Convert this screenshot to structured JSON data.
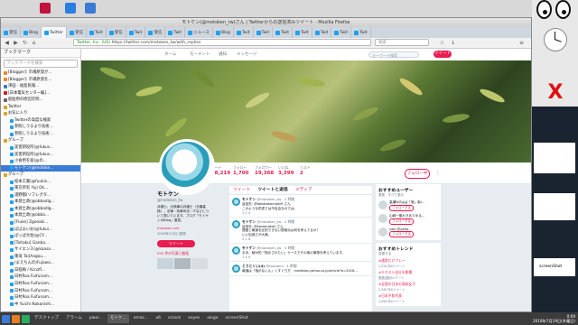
{
  "window": {
    "title": "モトケン(@motoken_tw)さん | Twitterからの送信済みツイート - Mozilla Firefox",
    "url_domain": "Twitter, Inc. (US)",
    "url_path": "https://twitter.com/motoken_tw/with_replies",
    "search_placeholder": "検索"
  },
  "tabs": [
    {
      "label": "受信"
    },
    {
      "label": "Blog"
    },
    {
      "label": "Twitter"
    },
    {
      "label": "受信"
    },
    {
      "label": "Twit"
    },
    {
      "label": "受信"
    },
    {
      "label": "Twit"
    },
    {
      "label": "受信"
    },
    {
      "label": "Twit"
    },
    {
      "label": "ニュース"
    },
    {
      "label": "Blog"
    },
    {
      "label": "Twit"
    },
    {
      "label": "Twit"
    },
    {
      "label": "Twit"
    },
    {
      "label": "Twit"
    },
    {
      "label": "Twit"
    },
    {
      "label": "Twit"
    },
    {
      "label": "Twit"
    }
  ],
  "sidebar": {
    "title": "ブックマーク",
    "search_placeholder": "ブックマークを検索",
    "items": [
      {
        "label": "[Blogger]: 市場原発が...",
        "color": "#f58220"
      },
      {
        "label": "[Blogger]: 市場原発を...",
        "color": "#f58220"
      },
      {
        "label": "津田 - 福島民報...",
        "color": "#3a7bd5"
      },
      {
        "label": "[日本電気センター編]...",
        "color": "#c22"
      },
      {
        "label": "船舶用の原因究明...",
        "color": "#666"
      },
      {
        "label": "Twitter",
        "color": "#d9a520"
      },
      {
        "label": "お気に入り",
        "color": "#d9a520"
      },
      {
        "label": "Twitterの高度な検索",
        "color": "#1da1f2"
      },
      {
        "label": "参照しうるより技術...",
        "color": "#1da1f2"
      },
      {
        "label": "参照しうるより技術...",
        "color": "#1da1f2"
      },
      {
        "label": "グループ",
        "color": "#d9a520"
      },
      {
        "label": "実害新役所(@fukus...",
        "color": "#1da1f2"
      },
      {
        "label": "実害新役所(@fukus...",
        "color": "#1da1f2"
      },
      {
        "label": "小食用を家(@の...",
        "color": "#1da1f2"
      },
      {
        "label": "モトケン(@motoke...",
        "color": "#1da1f2"
      },
      {
        "label": "グループ",
        "color": "#d9a520"
      },
      {
        "label": "松本工業(@fuukis...",
        "color": "#1da1f2"
      },
      {
        "label": "東京所有 Yuji Ok...",
        "color": "#1da1f2"
      },
      {
        "label": "浦野都(ソフレグタ...",
        "color": "#1da1f2"
      },
      {
        "label": "本源土政(@obbadig...",
        "color": "#1da1f2"
      },
      {
        "label": "本源土政(@obbadig...",
        "color": "#1da1f2"
      },
      {
        "label": "本源土政(@obba...",
        "color": "#1da1f2"
      },
      {
        "label": "[Fluke] Zgoeaki...",
        "color": "#1da1f2"
      },
      {
        "label": "ばばまいお(@fukui...",
        "color": "#1da1f2"
      },
      {
        "label": "ぱっぱ大佐(@CY...",
        "color": "#1da1f2"
      },
      {
        "label": "[Teitaku] Ganba...",
        "color": "#1da1f2"
      },
      {
        "label": "サイエンス(@kaasa...",
        "color": "#1da1f2"
      },
      {
        "label": "東海 Tai(Aagou...",
        "color": "#1da1f2"
      },
      {
        "label": "(まえちんの)Fujawa...",
        "color": "#1da1f2"
      },
      {
        "label": "日程梅 / Kcnzfl...",
        "color": "#1da1f2"
      },
      {
        "label": "日村Roa Fuifunam...",
        "color": "#1da1f2"
      },
      {
        "label": "日村Roa Fuifunam...",
        "color": "#1da1f2"
      },
      {
        "label": "日村Roa Fuifunam...",
        "color": "#1da1f2"
      },
      {
        "label": "日村Roa Fuifunam...",
        "color": "#1da1f2"
      },
      {
        "label": "中 Yuichi Nakanishi...",
        "color": "#1da1f2"
      }
    ]
  },
  "twitter": {
    "nav": [
      "ホーム",
      "モーメント",
      "通知",
      "メッセージ"
    ],
    "search_placeholder": "キーワード検索",
    "tweet_button": "ツイート",
    "stats": [
      {
        "label": "ツイート",
        "value": "108,219"
      },
      {
        "label": "フォロー",
        "value": "1,700"
      },
      {
        "label": "フォロワー",
        "value": "19,368"
      },
      {
        "label": "いいね",
        "value": "3,399"
      },
      {
        "label": "リスト",
        "value": "2"
      }
    ],
    "follow_button": "フォロー中",
    "profile": {
      "name": "モトケン",
      "handle": "@motoken_tw",
      "bio": "弁護士。元検事の弁護士（元最高検）。法律・刑事司法・ITなどについて書いています。ブログ「モトケンのBlog」運営。",
      "link": "motoken.net",
      "joined": "2009年12月に登録",
      "media_label": "555 件の写真と動画",
      "tweet_button": "ツイート"
    },
    "timeline_tabs": [
      "ツイート",
      "ツイートと返信",
      "メディア"
    ],
    "tweets": [
      {
        "name": "モトケン",
        "handle": "@motoken_tw · 2 時間",
        "text": "返信先: @bakatakamioki9 さん\nこのような供述では不自由なのでは。",
        "actions": "1   1   4"
      },
      {
        "name": "モトケン",
        "handle": "@motoken_tw · 2 時間",
        "text": "返信先: @kareshaka0 さん\n捜査と報道を区別できない提案派は何を考えてるの？\nいい加減さが大事。",
        "actions": "2   1   6"
      },
      {
        "name": "モトケン",
        "handle": "@motoken_tw · 3 時間",
        "text": "まあ、絶対的「指示されたい」ケースでその後の事態を考えています。",
        "actions": "1   4   9"
      },
      {
        "name": "とうとくい(4)",
        "handle": "@toutokui · 4 時間",
        "text": "報道は「指示ないん」くすぐり方　mediblos.yahoo.co.jp/article?a=2018...",
        "actions": ""
      }
    ],
    "suggestions": {
      "title": "おすすめユーザー",
      "sub": "更新 · すべて表示",
      "users": [
        {
          "name": "高瀬WZはは「瓶」新/...",
          "action": "フォローする"
        },
        {
          "name": "山崎一樹わきあらゆる...",
          "action": "フォローする"
        },
        {
          "name": "yalk @yalks",
          "action": "フォローする"
        }
      ]
    },
    "trends": {
      "title": "おすすめトレンド",
      "sub": "変更する",
      "items": [
        {
          "name": "#通常だけプレー",
          "sub": "1,234 件のツイート"
        },
        {
          "name": "#テキスト自分を影響",
          "sub": "関連話題のツイート"
        },
        {
          "name": "#全国の日本の高校女子",
          "sub": "2,345 件のツイート"
        },
        {
          "name": "#日本平和代表",
          "sub": "3,456 件のツイート"
        }
      ]
    }
  },
  "taskbar": {
    "items": [
      "デスクトップ",
      "アラーム",
      "pwor...",
      "モトケ...",
      "emac...",
      "a6",
      "xclock",
      "xeyes",
      "xlogo",
      "screenShot"
    ],
    "clock_time": "0:09",
    "clock_date": "2018年7月19日(木曜日)"
  },
  "right_panel": {
    "terminal_label": "screenShot"
  }
}
